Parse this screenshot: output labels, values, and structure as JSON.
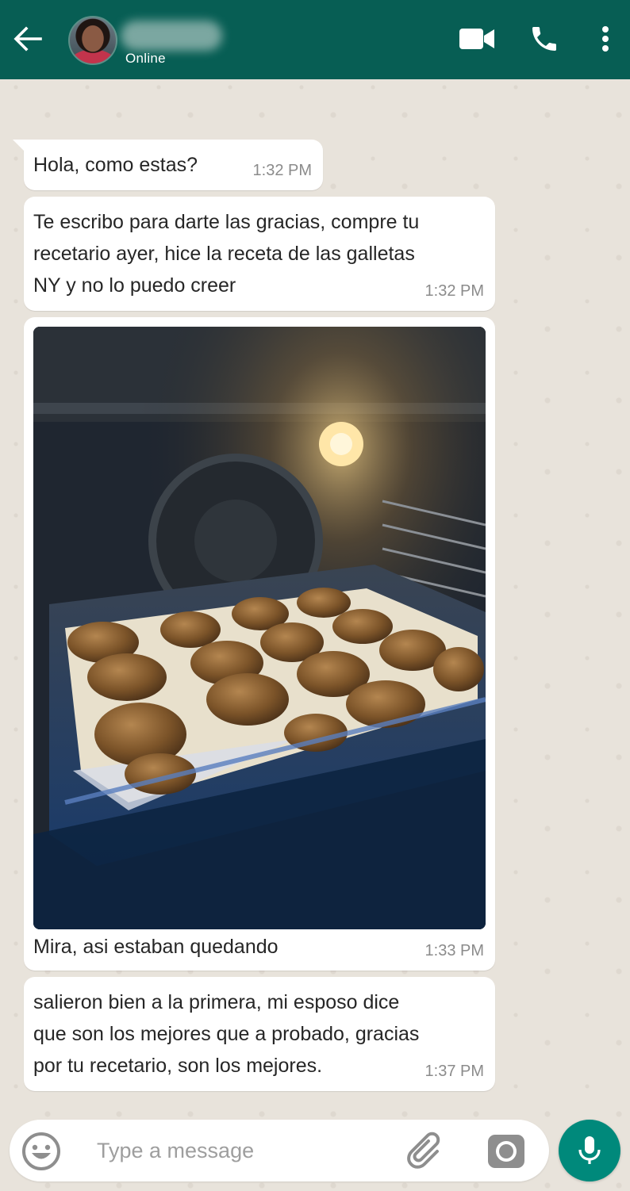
{
  "header": {
    "back_icon": "arrow-left-icon",
    "contact_name": "",
    "status": "Online",
    "video_icon": "videocam-icon",
    "call_icon": "phone-icon",
    "menu_icon": "more-vert-icon",
    "background_color": "#075e54"
  },
  "messages": [
    {
      "text": "Hola, como estas?",
      "time": "1:32 PM"
    },
    {
      "text": "Te escribo para darte las gracias, compre tu\nrecetario ayer, hice la receta de las galletas\nNY y no lo puedo creer",
      "time": "1:32 PM"
    },
    {
      "image": "oven-cookies-photo",
      "text": "Mira, asi estaban quedando",
      "time": "1:33 PM"
    },
    {
      "text": "salieron bien a la primera, mi esposo dice\nque son los mejores que a probado, gracias\npor tu recetario, son los mejores.",
      "time": "1:37 PM"
    }
  ],
  "input": {
    "placeholder": "Type a message",
    "value": "",
    "emoji_icon": "emoji-icon",
    "attach_icon": "paperclip-icon",
    "camera_icon": "camera-icon",
    "mic_icon": "mic-icon",
    "mic_color": "#00897b"
  },
  "colors": {
    "chat_background": "#e8e3db",
    "bubble": "#ffffff",
    "timestamp": "#8b8b8b"
  }
}
